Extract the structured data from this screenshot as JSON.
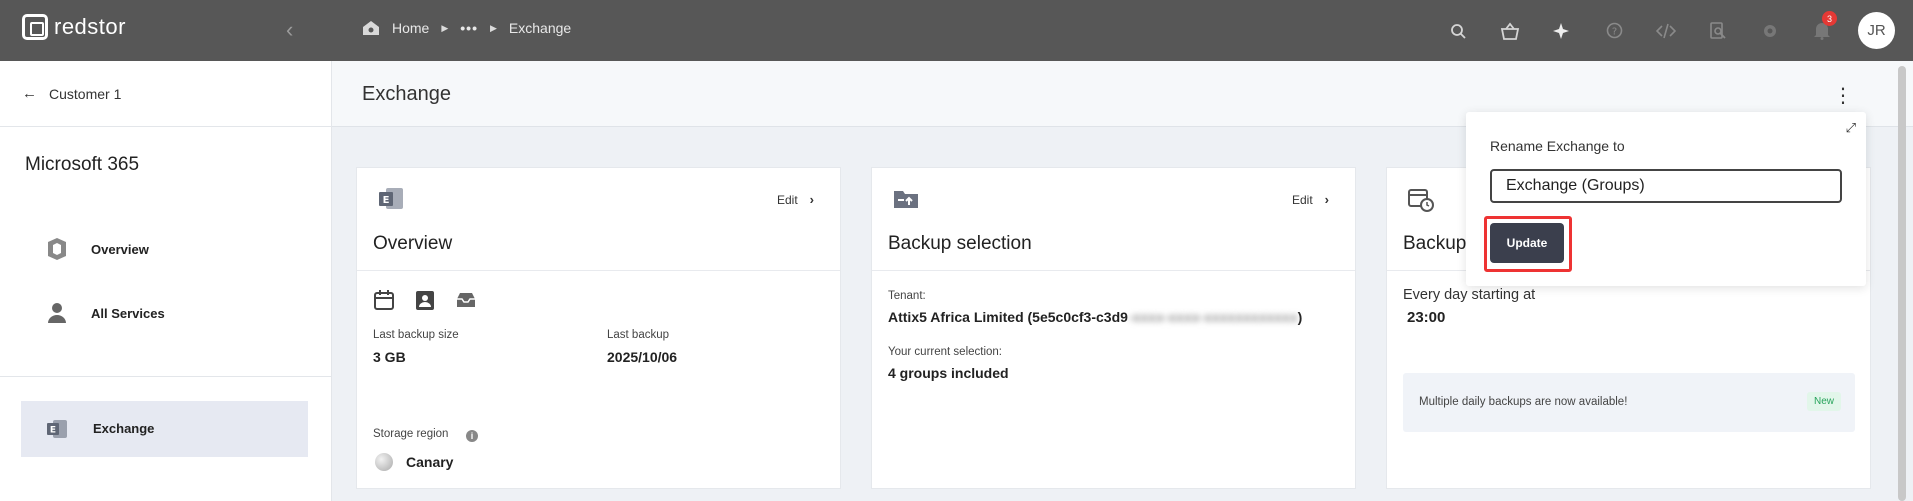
{
  "brand": {
    "name": "redstor"
  },
  "breadcrumb": {
    "home": "Home",
    "ellipsis": "•••",
    "current": "Exchange"
  },
  "topbar": {
    "notifications_count": "3",
    "avatar_initials": "JR",
    "icons": [
      "search-icon",
      "basket-icon",
      "sparkle-icon",
      "help-icon",
      "code-icon",
      "scan-icon",
      "gear-icon",
      "bell-icon"
    ]
  },
  "sidebar": {
    "back_label": "Customer 1",
    "section_title": "Microsoft 365",
    "items": [
      {
        "label": "Overview"
      },
      {
        "label": "All Services"
      }
    ],
    "active_item": {
      "label": "Exchange"
    }
  },
  "page": {
    "title": "Exchange"
  },
  "cards": {
    "overview": {
      "edit": "Edit",
      "title": "Overview",
      "last_backup_size_label": "Last backup size",
      "last_backup_size": "3 GB",
      "last_backup_label": "Last backup",
      "last_backup": "2025/10/06",
      "storage_region_label": "Storage region",
      "storage_region": "Canary"
    },
    "backup_selection": {
      "edit": "Edit",
      "title": "Backup selection",
      "tenant_label": "Tenant:",
      "tenant_prefix": "Attix5 Africa Limited (5e5c0cf3-c3d9",
      "tenant_blurred": "-xxxx-xxxx-xxxxxxxxxxxx",
      "tenant_suffix": ")",
      "selection_label": "Your current selection:",
      "selection_value": "4 groups included"
    },
    "backup": {
      "title": "Backup",
      "schedule_label": "Every day starting at",
      "schedule_time": "23:00",
      "notice": "Multiple daily backups are now available!",
      "notice_badge": "New"
    }
  },
  "rename_popover": {
    "label": "Rename Exchange to",
    "input_value": "Exchange (Groups)",
    "button": "Update"
  }
}
